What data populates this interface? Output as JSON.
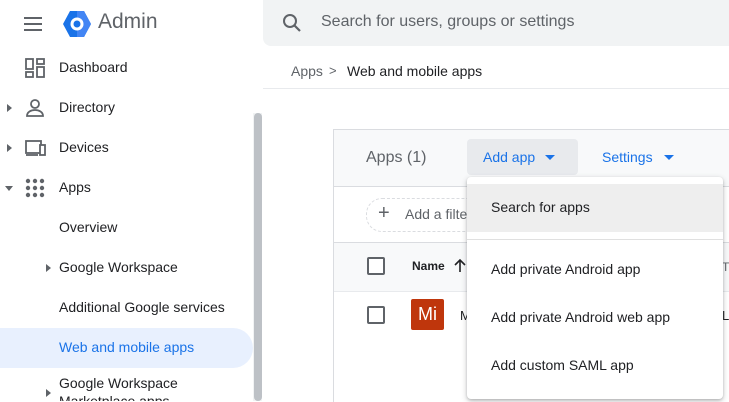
{
  "header": {
    "brand": "Admin",
    "search_placeholder": "Search for users, groups or settings",
    "logo_color": "#1a73e8"
  },
  "sidebar": {
    "items": [
      {
        "label": "Dashboard",
        "icon": "dashboard-icon"
      },
      {
        "label": "Directory",
        "icon": "person-icon",
        "expandable": true
      },
      {
        "label": "Devices",
        "icon": "devices-icon",
        "expandable": true
      },
      {
        "label": "Apps",
        "icon": "apps-grid-icon",
        "expanded": true
      },
      {
        "label": "Overview"
      },
      {
        "label": "Google Workspace",
        "expandable": true
      },
      {
        "label": "Additional Google services"
      },
      {
        "label": "Web and mobile apps",
        "active": true
      },
      {
        "label": "Google Workspace Marketplace apps",
        "expandable": true
      }
    ]
  },
  "breadcrumb": {
    "parent": "Apps",
    "separator": ">",
    "current": "Web and mobile apps"
  },
  "card": {
    "apps_count": "Apps (1)",
    "add_app": "Add app",
    "settings": "Settings",
    "filter_placeholder": "Add a filter",
    "column_name": "Name",
    "col3_partial": "T",
    "row": {
      "avatar": "Mi",
      "name_partial": "M",
      "col3_partial": "L"
    }
  },
  "dropdown": {
    "items": [
      {
        "label": "Search for apps",
        "highlighted": true
      },
      {
        "label": "Add private Android app"
      },
      {
        "label": "Add private Android web app"
      },
      {
        "label": "Add custom SAML app"
      }
    ]
  },
  "colors": {
    "accent": "#1a73e8",
    "active_bg": "#e8f0fe",
    "avatar_bg": "#bf360c"
  }
}
